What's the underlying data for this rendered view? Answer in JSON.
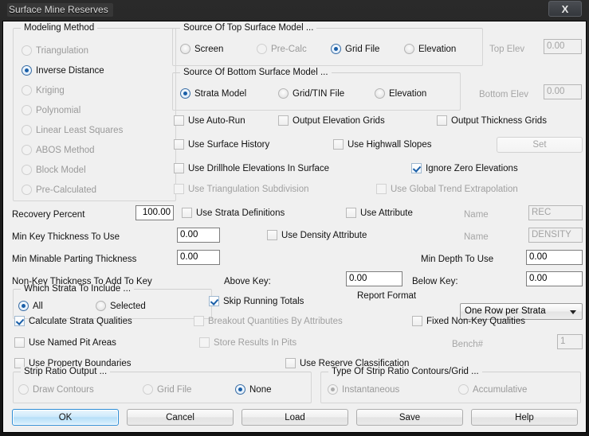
{
  "window": {
    "title": "Surface Mine Reserves",
    "close_label": "X"
  },
  "modeling_method": {
    "legend": "Modeling Method",
    "options": [
      {
        "label": "Triangulation",
        "selected": false,
        "disabled": true
      },
      {
        "label": "Inverse Distance",
        "selected": true,
        "disabled": false
      },
      {
        "label": "Kriging",
        "selected": false,
        "disabled": true
      },
      {
        "label": "Polynomial",
        "selected": false,
        "disabled": true
      },
      {
        "label": "Linear Least Squares",
        "selected": false,
        "disabled": true
      },
      {
        "label": "ABOS Method",
        "selected": false,
        "disabled": true
      },
      {
        "label": "Block Model",
        "selected": false,
        "disabled": true
      },
      {
        "label": "Pre-Calculated",
        "selected": false,
        "disabled": true
      }
    ]
  },
  "top_surface": {
    "legend": "Source Of Top Surface Model ...",
    "options": [
      {
        "label": "Screen",
        "selected": false,
        "disabled": false
      },
      {
        "label": "Pre-Calc",
        "selected": false,
        "disabled": true
      },
      {
        "label": "Grid File",
        "selected": true,
        "disabled": false
      },
      {
        "label": "Elevation",
        "selected": false,
        "disabled": false
      }
    ],
    "elev_label": "Top Elev",
    "elev_value": "0.00"
  },
  "bottom_surface": {
    "legend": "Source Of Bottom Surface Model ...",
    "options": [
      {
        "label": "Strata Model",
        "selected": true,
        "disabled": false
      },
      {
        "label": "Grid/TIN File",
        "selected": false,
        "disabled": false
      },
      {
        "label": "Elevation",
        "selected": false,
        "disabled": false
      }
    ],
    "elev_label": "Bottom Elev",
    "elev_value": "0.00"
  },
  "options_checks": {
    "use_auto_run": {
      "label": "Use Auto-Run",
      "checked": false,
      "disabled": false
    },
    "output_elevation_grids": {
      "label": "Output Elevation Grids",
      "checked": false,
      "disabled": false
    },
    "output_thickness_grids": {
      "label": "Output Thickness Grids",
      "checked": false,
      "disabled": false
    },
    "use_surface_history": {
      "label": "Use Surface History",
      "checked": false,
      "disabled": false
    },
    "use_highwall_slopes": {
      "label": "Use Highwall Slopes",
      "checked": false,
      "disabled": false
    },
    "set_button": {
      "label": "Set",
      "disabled": true
    },
    "use_drillhole_elevations": {
      "label": "Use Drillhole Elevations In Surface",
      "checked": false,
      "disabled": false
    },
    "ignore_zero_elevations": {
      "label": "Ignore Zero Elevations",
      "checked": true,
      "disabled": false
    },
    "use_triangulation_subdivision": {
      "label": "Use Triangulation Subdivision",
      "checked": false,
      "disabled": true
    },
    "use_global_trend_extrapolation": {
      "label": "Use Global Trend Extrapolation",
      "checked": false,
      "disabled": true
    }
  },
  "params": {
    "recovery_percent_label": "Recovery Percent",
    "recovery_percent_value": "100.00",
    "use_strata_definitions": {
      "label": "Use Strata Definitions",
      "checked": false,
      "disabled": false
    },
    "use_attribute": {
      "label": "Use Attribute",
      "checked": false,
      "disabled": false
    },
    "name_label_1": "Name",
    "name_value_1": "REC",
    "min_key_thickness_label": "Min Key Thickness To Use",
    "min_key_thickness_value": "0.00",
    "use_density_attribute": {
      "label": "Use Density Attribute",
      "checked": false,
      "disabled": false
    },
    "name_label_2": "Name",
    "name_value_2": "DENSITY",
    "min_minable_parting_label": "Min Minable Parting Thickness",
    "min_minable_parting_value": "0.00",
    "min_depth_label": "Min Depth To Use",
    "min_depth_value": "0.00",
    "non_key_thickness_label": "Non-Key Thickness To Add To Key",
    "above_key_label": "Above Key:",
    "above_key_value": "0.00",
    "below_key_label": "Below Key:",
    "below_key_value": "0.00"
  },
  "which_strata": {
    "legend": "Which Strata To Include ...",
    "options": [
      {
        "label": "All",
        "selected": true,
        "disabled": false
      },
      {
        "label": "Selected",
        "selected": false,
        "disabled": false
      }
    ]
  },
  "report": {
    "skip_running_totals": {
      "label": "Skip Running Totals",
      "checked": true,
      "disabled": false
    },
    "report_format_label": "Report Format",
    "report_format_value": "One Row per Strata",
    "report_format_options": [
      "One Row per Strata"
    ],
    "calculate_strata_qualities": {
      "label": "Calculate Strata Qualities",
      "checked": true,
      "disabled": false
    },
    "breakout_quantities": {
      "label": "Breakout Quantities By Attributes",
      "checked": false,
      "disabled": true
    },
    "fixed_non_key_qualities": {
      "label": "Fixed Non-Key Qualities",
      "checked": false,
      "disabled": false
    },
    "use_named_pit_areas": {
      "label": "Use Named Pit Areas",
      "checked": false,
      "disabled": false
    },
    "store_results_in_pits": {
      "label": "Store Results In Pits",
      "checked": false,
      "disabled": true
    },
    "bench_label": "Bench#",
    "bench_value": "1",
    "use_property_boundaries": {
      "label": "Use Property Boundaries",
      "checked": false,
      "disabled": false
    },
    "use_reserve_classification": {
      "label": "Use Reserve Classification",
      "checked": false,
      "disabled": false
    }
  },
  "strip_ratio_output": {
    "legend": "Strip Ratio Output ...",
    "options": [
      {
        "label": "Draw Contours",
        "selected": false,
        "disabled": true
      },
      {
        "label": "Grid File",
        "selected": false,
        "disabled": true
      },
      {
        "label": "None",
        "selected": true,
        "disabled": false
      }
    ]
  },
  "strip_ratio_type": {
    "legend": "Type Of Strip Ratio Contours/Grid ...",
    "options": [
      {
        "label": "Instantaneous",
        "selected": true,
        "disabled": true
      },
      {
        "label": "Accumulative",
        "selected": false,
        "disabled": true
      }
    ]
  },
  "buttons": {
    "ok": "OK",
    "cancel": "Cancel",
    "load": "Load",
    "save": "Save",
    "help": "Help"
  },
  "colors": {
    "accent": "#1a5fa8",
    "dialog_bg": "#f0f0f0",
    "titlebar": "#1d1d1d",
    "default_button_border": "#2c8dd6"
  }
}
